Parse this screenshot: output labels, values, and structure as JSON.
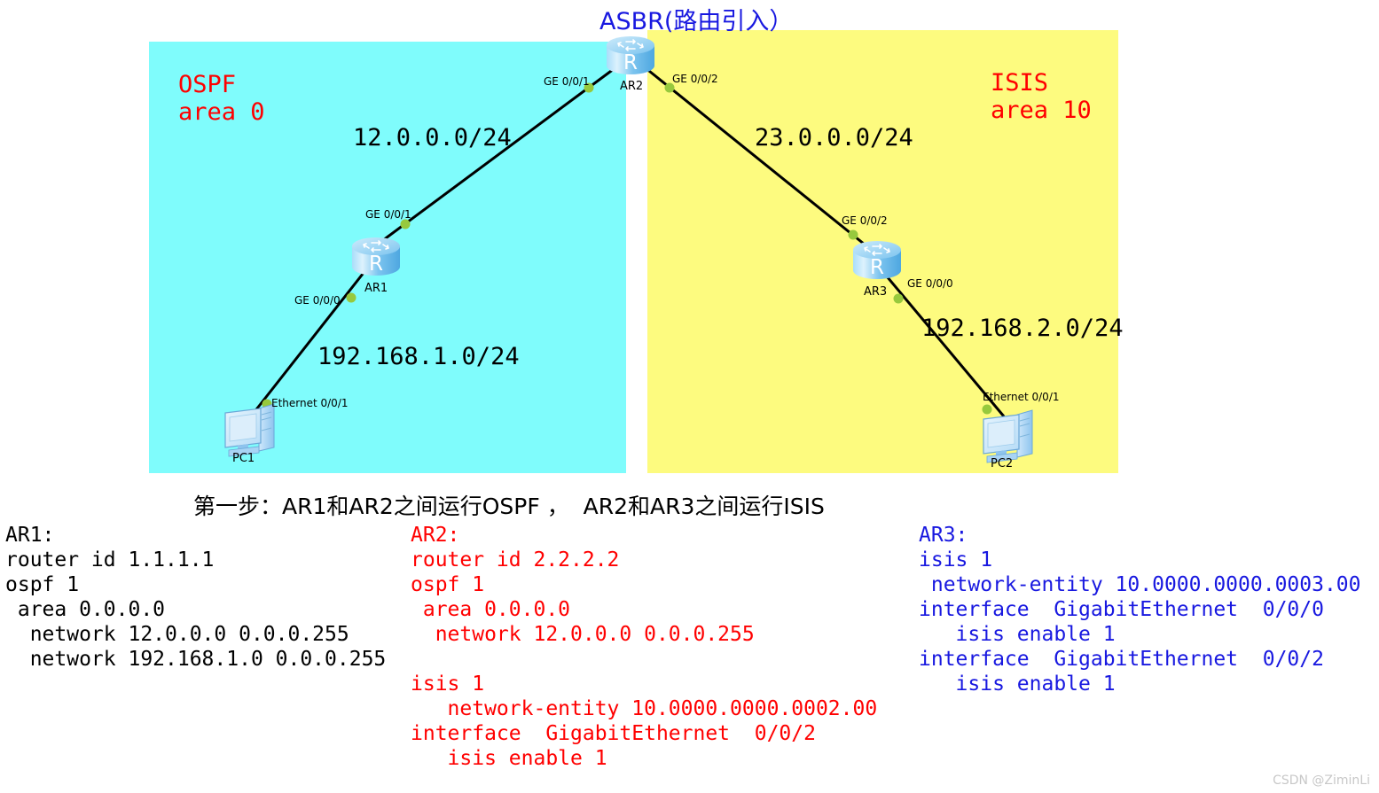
{
  "title": {
    "asbr": "ASBR(路由引入）"
  },
  "regions": {
    "ospf": {
      "name": "OSPF region",
      "caption": "OSPF\narea 0",
      "color": "#7ffcfc",
      "text_color": "#ff0000"
    },
    "isis": {
      "name": "ISIS region",
      "caption": "ISIS\narea 10",
      "color": "#fdfb7f",
      "text_color": "#ff0000"
    }
  },
  "subnets": {
    "ar1_ar2": "12.0.0.0/24",
    "ar2_ar3": "23.0.0.0/24",
    "pc1_ar1": "192.168.1.0/24",
    "ar3_pc2": "192.168.2.0/24"
  },
  "devices": {
    "ar1": "AR1",
    "ar2": "AR2",
    "ar3": "AR3",
    "pc1": "PC1",
    "pc2": "PC2"
  },
  "interfaces": {
    "ar2_to_ar1": "GE 0/0/1",
    "ar2_to_ar3": "GE 0/0/2",
    "ar1_to_ar2": "GE 0/0/1",
    "ar1_to_pc1": "GE 0/0/0",
    "ar3_to_ar2": "GE 0/0/2",
    "ar3_to_pc2": "GE 0/0/0",
    "pc1_to_ar1": "Ethernet 0/0/1",
    "pc2_to_ar3": "Ethernet 0/0/1"
  },
  "step_caption": "第一步：AR1和AR2之间运行OSPF ，  AR2和AR3之间运行ISIS",
  "configs": {
    "ar1": {
      "color": "#000000",
      "text": "AR1:\nrouter id 1.1.1.1\nospf 1\n area 0.0.0.0\n  network 12.0.0.0 0.0.0.255\n  network 192.168.1.0 0.0.0.255"
    },
    "ar2": {
      "color": "#ff0000",
      "text": "AR2:\nrouter id 2.2.2.2\nospf 1\n area 0.0.0.0\n  network 12.0.0.0 0.0.0.255\n\nisis 1\n   network-entity 10.0000.0000.0002.00\ninterface  GigabitEthernet  0/0/2\n   isis enable 1"
    },
    "ar3": {
      "color": "#1818e0",
      "text": "AR3:\nisis 1\n network-entity 10.0000.0000.0003.00\ninterface  GigabitEthernet  0/0/0\n   isis enable 1\ninterface  GigabitEthernet  0/0/2\n   isis enable 1"
    }
  },
  "watermark": "CSDN @ZiminLi",
  "colors": {
    "link": "#000000",
    "port_dot": "#97c93d",
    "router_body": "#7ec9f2",
    "router_top": "#b8e3fa",
    "pc_body": "#a8d4f5"
  }
}
